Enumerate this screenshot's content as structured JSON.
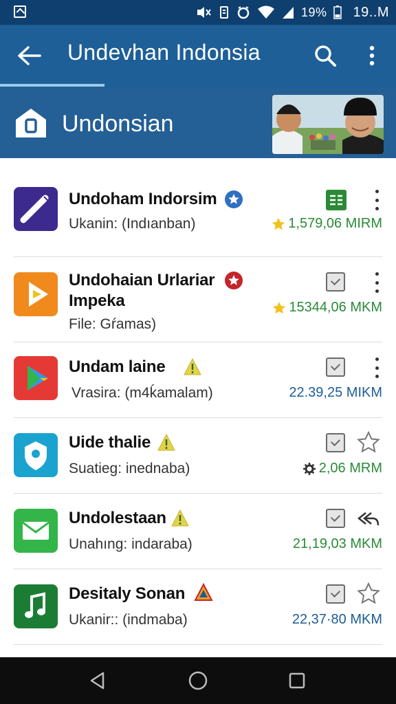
{
  "status_bar": {
    "battery_percent": "19%",
    "clock": "19..M",
    "icons": [
      "gallery-icon",
      "mute-icon",
      "vibrate-icon",
      "alarm-icon",
      "wifi-icon",
      "signal-icon",
      "battery-icon"
    ]
  },
  "app_bar": {
    "title": "Undevhan Indonsia",
    "icons": [
      "back-arrow-icon",
      "search-icon",
      "overflow-menu-icon"
    ]
  },
  "banner": {
    "title": "Undonsian",
    "logo_icon": "house-logo-icon"
  },
  "apps": [
    {
      "name": "Undoham Indorsim",
      "subtitle": "Ukanin: (Indıanban)",
      "stat": "1,579,06 MIRM",
      "stat_prefix_icon": "star-icon",
      "stat_color": "green",
      "badge": "blue-star-badge",
      "action_icon": "spreadsheet-icon",
      "trailing_icon": "more-vert-icon",
      "icon": "ruler-icon",
      "icon_color": "#3d2a8f"
    },
    {
      "name": "Undohaian Urlariar",
      "name_line2": "Impeka",
      "subtitle": "File: Gŕamas)",
      "stat": "15344,06 MKM",
      "stat_prefix_icon": "star-icon",
      "stat_color": "green",
      "badge": "red-star-badge",
      "action_icon": "checkbox-icon",
      "trailing_icon": "more-vert-icon",
      "icon": "play-arrow-icon",
      "icon_color": "#f08a1c"
    },
    {
      "name": "Undam laine",
      "subtitle": "Vrasira: (m4ḱamalam)",
      "stat": "22.39,25 MIKM",
      "stat_color": "blue",
      "badge": "warning-badge",
      "action_icon": "checkbox-icon",
      "trailing_icon": "more-vert-icon",
      "icon": "play-store-icon",
      "icon_color": "#e53935"
    },
    {
      "name": "Uide thalie",
      "subtitle": "Suatieg: inednaba)",
      "stat": "2,06 MRM",
      "stat_prefix_icon": "gear-icon",
      "stat_color": "green",
      "badge": "warning-badge",
      "action_icon": "checkbox-icon",
      "trailing_icon": "star-outline-icon",
      "icon": "shield-location-icon",
      "icon_color": "#1aa3cf"
    },
    {
      "name": "Undolestaan",
      "subtitle": "Unahıng: indaraba)",
      "stat": "21,19,03 MKM",
      "stat_color": "green",
      "badge": "warning-badge",
      "action_icon": "checkbox-icon",
      "trailing_icon": "reply-arrow-icon",
      "icon": "mail-icon",
      "icon_color": "#34b54a"
    },
    {
      "name": "Desitaly Sonan",
      "subtitle": "Ukanir:: (indmaba)",
      "stat": "22,37·80 MKM",
      "stat_color": "blue",
      "badge": "triangle-warning-badge",
      "action_icon": "checkbox-icon",
      "trailing_icon": "star-outline-icon",
      "icon": "music-note-icon",
      "icon_color": "#1b7d34"
    }
  ],
  "nav_bar": {
    "icons": [
      "back-triangle-icon",
      "home-circle-icon",
      "recents-square-icon"
    ]
  },
  "colors": {
    "status_bar": "#0f3f6f",
    "app_bar": "#1e5f97",
    "banner": "#245f96",
    "stat_green": "#2a8a37",
    "stat_blue": "#1d5d95"
  }
}
